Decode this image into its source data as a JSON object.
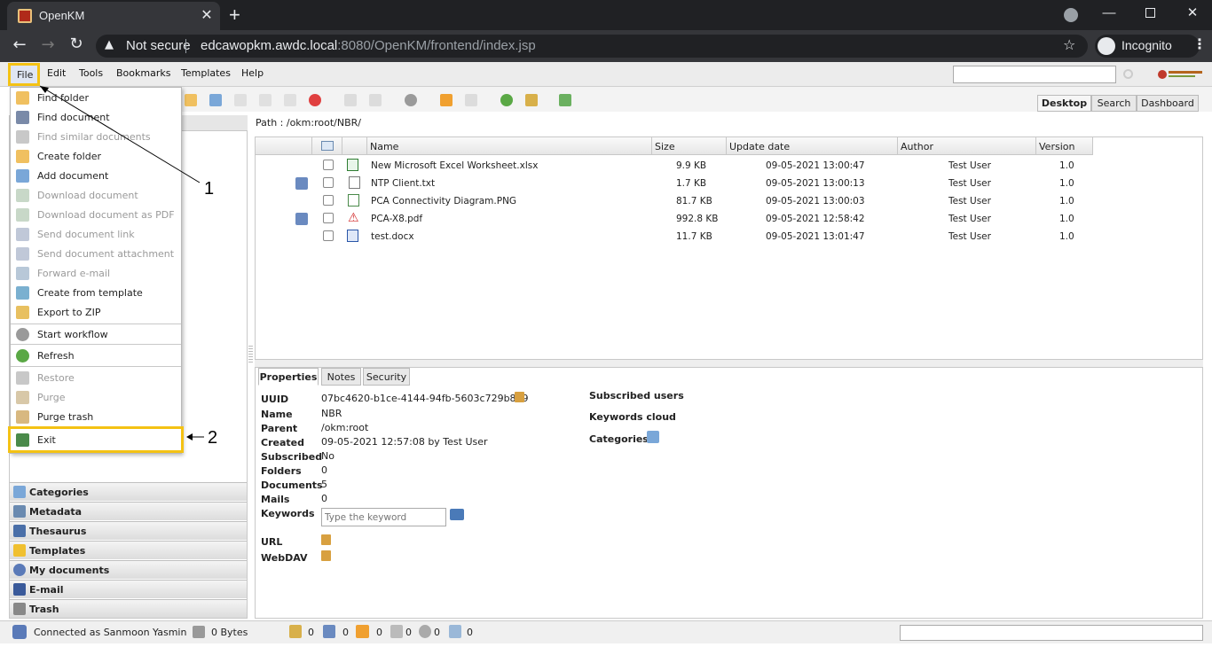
{
  "browser": {
    "tab_title": "OpenKM",
    "tab_close": "✕",
    "new_tab": "+",
    "security_warning": "Not secure",
    "url_host": "edcawopkm.awdc.local",
    "url_rest": ":8080/OpenKM/frontend/index.jsp",
    "incognito_label": "Incognito"
  },
  "menubar": [
    "File",
    "Edit",
    "Tools",
    "Bookmarks",
    "Templates",
    "Help"
  ],
  "view_tabs": [
    "Desktop",
    "Search",
    "Dashboard"
  ],
  "file_menu": {
    "items": [
      {
        "label": "Find folder",
        "enabled": true
      },
      {
        "label": "Find document",
        "enabled": true
      },
      {
        "label": "Find similar documents",
        "enabled": false
      },
      {
        "label": "Create folder",
        "enabled": true
      },
      {
        "label": "Add document",
        "enabled": true
      },
      {
        "label": "Download document",
        "enabled": false
      },
      {
        "label": "Download document as PDF",
        "enabled": false
      },
      {
        "label": "Send document link",
        "enabled": false
      },
      {
        "label": "Send document attachment",
        "enabled": false
      },
      {
        "label": "Forward e-mail",
        "enabled": false
      },
      {
        "label": "Create from template",
        "enabled": true
      },
      {
        "label": "Export to ZIP",
        "enabled": true
      },
      {
        "label": "Start workflow",
        "enabled": true
      },
      {
        "label": "Refresh",
        "enabled": true
      },
      {
        "label": "Restore",
        "enabled": false
      },
      {
        "label": "Purge",
        "enabled": false
      },
      {
        "label": "Purge trash",
        "enabled": true
      },
      {
        "label": "Exit",
        "enabled": true
      }
    ]
  },
  "annotations": {
    "one": "1",
    "two": "2"
  },
  "left_stacks": [
    "Categories",
    "Metadata",
    "Thesaurus",
    "Templates",
    "My documents",
    "E-mail",
    "Trash"
  ],
  "path": "Path : /okm:root/NBR/",
  "grid": {
    "headers": [
      "Name",
      "Size",
      "Update date",
      "Author",
      "Version"
    ],
    "rows": [
      {
        "name": "New Microsoft Excel Worksheet.xlsx",
        "size": "9.9 KB",
        "date": "09-05-2021 13:00:47",
        "author": "Test User",
        "version": "1.0"
      },
      {
        "name": "NTP Client.txt",
        "size": "1.7 KB",
        "date": "09-05-2021 13:00:13",
        "author": "Test User",
        "version": "1.0"
      },
      {
        "name": "PCA Connectivity Diagram.PNG",
        "size": "81.7 KB",
        "date": "09-05-2021 13:00:03",
        "author": "Test User",
        "version": "1.0"
      },
      {
        "name": "PCA-X8.pdf",
        "size": "992.8 KB",
        "date": "09-05-2021 12:58:42",
        "author": "Test User",
        "version": "1.0"
      },
      {
        "name": "test.docx",
        "size": "11.7 KB",
        "date": "09-05-2021 13:01:47",
        "author": "Test User",
        "version": "1.0"
      }
    ]
  },
  "props_tabs": [
    "Properties",
    "Notes",
    "Security"
  ],
  "properties": {
    "uuid_label": "UUID",
    "uuid": "07bc4620-b1ce-4144-94fb-5603c729b8b9",
    "name_label": "Name",
    "name": "NBR",
    "parent_label": "Parent",
    "parent": "/okm:root",
    "created_label": "Created",
    "created": "09-05-2021 12:57:08 by Test User",
    "subscribed_label": "Subscribed",
    "subscribed": "No",
    "folders_label": "Folders",
    "folders": "0",
    "documents_label": "Documents",
    "documents": "5",
    "mails_label": "Mails",
    "mails": "0",
    "keywords_label": "Keywords",
    "keyword_placeholder": "Type the keyword",
    "url_label": "URL",
    "webdav_label": "WebDAV",
    "subscribed_users": "Subscribed users",
    "keywords_cloud": "Keywords cloud",
    "categories": "Categories"
  },
  "status": {
    "connected": "Connected as Sanmoon Yasmin",
    "bytes": "0 Bytes",
    "counters": [
      "0",
      "0",
      "0",
      "0",
      "0",
      "0"
    ]
  }
}
